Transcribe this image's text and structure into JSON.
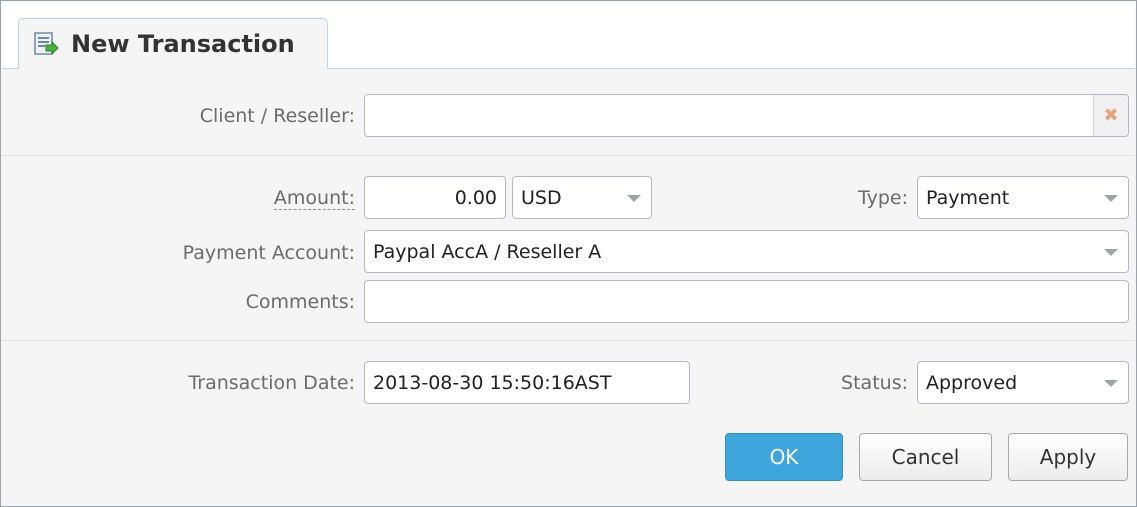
{
  "tab": {
    "title": "New Transaction",
    "icon": "transaction-form-icon"
  },
  "form": {
    "client_reseller": {
      "label": "Client / Reseller:",
      "value": "",
      "clear_icon": "✖"
    },
    "amount": {
      "label": "Amount:",
      "value": "0.00"
    },
    "currency": {
      "value": "USD"
    },
    "type": {
      "label": "Type:",
      "value": "Payment"
    },
    "payment_account": {
      "label": "Payment Account:",
      "value": "Paypal AccA / Reseller A"
    },
    "comments": {
      "label": "Comments:",
      "value": ""
    },
    "transaction_date": {
      "label": "Transaction Date:",
      "value": "2013-08-30 15:50:16AST"
    },
    "status": {
      "label": "Status:",
      "value": "Approved"
    }
  },
  "buttons": {
    "ok": "OK",
    "cancel": "Cancel",
    "apply": "Apply"
  },
  "colors": {
    "primary": "#3fa5dd",
    "clear_icon": "#e7a37a"
  }
}
